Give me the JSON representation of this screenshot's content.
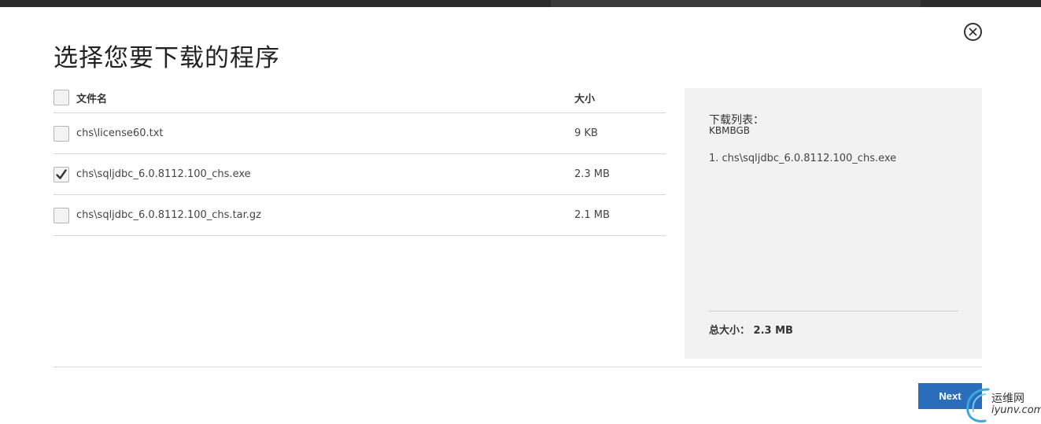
{
  "dialog": {
    "title": "选择您要下载的程序"
  },
  "table": {
    "header": {
      "name": "文件名",
      "size": "大小"
    },
    "rows": [
      {
        "name": "chs\\license60.txt",
        "size": "9 KB",
        "checked": false
      },
      {
        "name": "chs\\sqljdbc_6.0.8112.100_chs.exe",
        "size": "2.3 MB",
        "checked": true
      },
      {
        "name": "chs\\sqljdbc_6.0.8112.100_chs.tar.gz",
        "size": "2.1 MB",
        "checked": false
      }
    ]
  },
  "panel": {
    "label": "下载列表：",
    "units": "KBMBGB",
    "items": [
      "1. chs\\sqljdbc_6.0.8112.100_chs.exe"
    ],
    "total": "总大小： 2.3 MB"
  },
  "footer": {
    "next_label": "Next"
  },
  "watermark": {
    "cn": "运维网",
    "en": "iyunv.com"
  },
  "colors": {
    "accent": "#2a6ebb",
    "panel_bg": "#f2f2f2"
  }
}
